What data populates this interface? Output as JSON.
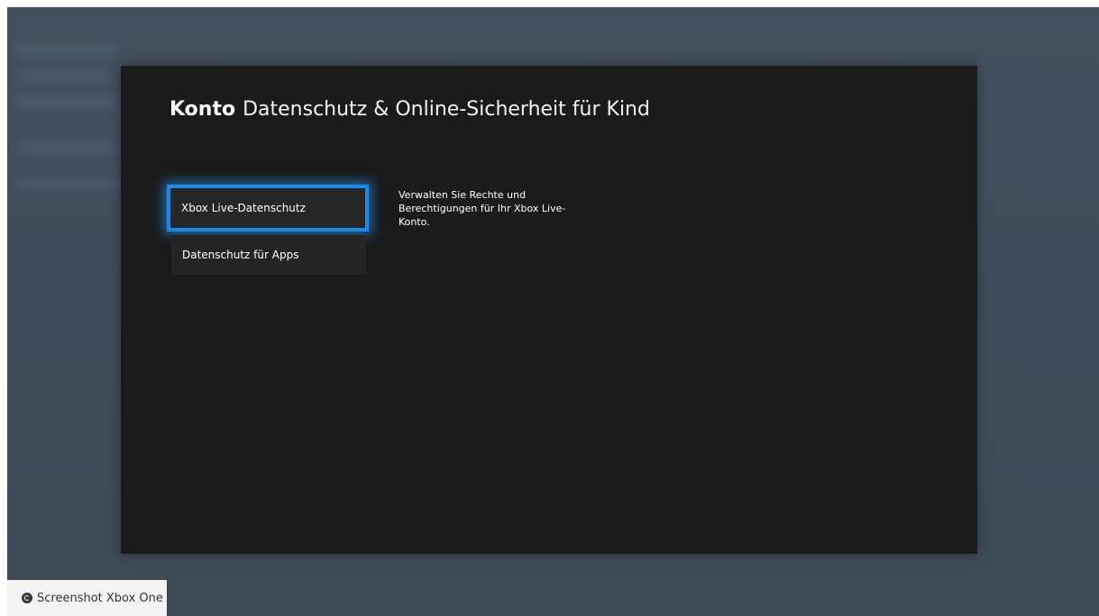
{
  "header": {
    "section": "Konto",
    "title": "Datenschutz & Online-Sicherheit für Kind"
  },
  "menu": {
    "items": [
      {
        "label": "Xbox Live-Datenschutz",
        "selected": true
      },
      {
        "label": "Datenschutz für Apps",
        "selected": false
      }
    ]
  },
  "description": "Verwalten Sie Rechte und Berechtigungen für Ihr Xbox Live-Konto.",
  "watermark": {
    "icon": "copyright-icon",
    "text": "Screenshot Xbox One"
  },
  "colors": {
    "accent": "#1e88e5",
    "panel": "#1b1b1b",
    "background": "#42505d"
  }
}
